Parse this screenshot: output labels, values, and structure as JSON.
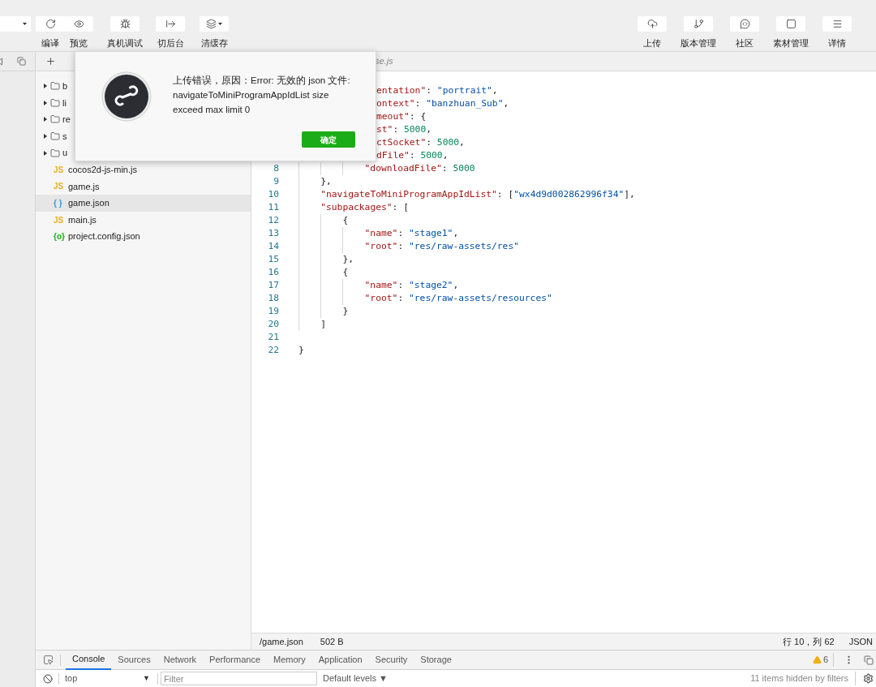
{
  "toolbar": {
    "left": [
      {
        "label": "编译",
        "dropdown": false
      },
      {
        "label": "预览",
        "dropdown": false
      },
      {
        "label": "真机调试",
        "dropdown": false
      },
      {
        "label": "切后台",
        "dropdown": false
      },
      {
        "label": "清缓存",
        "dropdown": true
      }
    ],
    "right": [
      {
        "label": "上传"
      },
      {
        "label": "版本管理"
      },
      {
        "label": "社区"
      },
      {
        "label": "素材管理"
      },
      {
        "label": "详情"
      }
    ]
  },
  "editor_tab": {
    "label": "se.js"
  },
  "file_tree": [
    {
      "kind": "folder",
      "label": "b",
      "selected": false
    },
    {
      "kind": "folder",
      "label": "li",
      "selected": false
    },
    {
      "kind": "folder",
      "label": "re",
      "selected": false
    },
    {
      "kind": "folder",
      "label": "s",
      "selected": false
    },
    {
      "kind": "folder",
      "label": "u",
      "selected": false
    },
    {
      "kind": "js",
      "icon_text": "JS",
      "label": "cocos2d-js-min.js",
      "selected": false
    },
    {
      "kind": "js",
      "icon_text": "JS",
      "label": "game.js",
      "selected": false
    },
    {
      "kind": "json",
      "icon_text": "{ }",
      "label": "game.json",
      "selected": true
    },
    {
      "kind": "js",
      "icon_text": "JS",
      "label": "main.js",
      "selected": false
    },
    {
      "kind": "config",
      "icon_text": "{o}",
      "label": "project.config.json",
      "selected": false
    }
  ],
  "code": [
    {
      "kind": "partial",
      "tokens": [
        {
          "kind": "key",
          "text": "entation\""
        },
        {
          "kind": "punct",
          "text": ": "
        },
        {
          "kind": "string",
          "text": "\"portrait\""
        },
        {
          "kind": "punct",
          "text": ","
        }
      ]
    },
    {
      "kind": "partial",
      "tokens": [
        {
          "kind": "key",
          "text": "ontext\""
        },
        {
          "kind": "punct",
          "text": ": "
        },
        {
          "kind": "string",
          "text": "\"banzhuan_Sub\""
        },
        {
          "kind": "punct",
          "text": ","
        }
      ]
    },
    {
      "kind": "partial",
      "tokens": [
        {
          "kind": "key",
          "text": "meout\""
        },
        {
          "kind": "punct",
          "text": ": {"
        }
      ]
    },
    {
      "kind": "partial",
      "tokens": [
        {
          "kind": "key",
          "text": "st\""
        },
        {
          "kind": "punct",
          "text": ": "
        },
        {
          "kind": "number",
          "text": "5000"
        },
        {
          "kind": "punct",
          "text": ","
        }
      ]
    },
    {
      "kind": "partial",
      "tokens": [
        {
          "kind": "key",
          "text": "ctSocket\""
        },
        {
          "kind": "punct",
          "text": ": "
        },
        {
          "kind": "number",
          "text": "5000"
        },
        {
          "kind": "punct",
          "text": ","
        }
      ]
    },
    {
      "kind": "partial",
      "tokens": [
        {
          "kind": "key",
          "text": "dFile\""
        },
        {
          "kind": "punct",
          "text": ": "
        },
        {
          "kind": "number",
          "text": "5000"
        },
        {
          "kind": "punct",
          "text": ","
        }
      ]
    },
    {
      "kind": "full",
      "number": "8",
      "guides": [
        true,
        true,
        true
      ],
      "tokens": [
        {
          "kind": "key",
          "text": "\"downloadFile\""
        },
        {
          "kind": "punct",
          "text": ": "
        },
        {
          "kind": "number",
          "text": "5000"
        }
      ]
    },
    {
      "kind": "full",
      "number": "9",
      "guides": [
        true
      ],
      "tokens": [
        {
          "kind": "punct",
          "text": "},"
        }
      ]
    },
    {
      "kind": "full",
      "number": "10",
      "guides": [
        true
      ],
      "tokens": [
        {
          "kind": "key",
          "text": "\"navigateToMiniProgramAppIdList\""
        },
        {
          "kind": "punct",
          "text": ": ["
        },
        {
          "kind": "string",
          "text": "\"wx4d9d002862996f34\""
        },
        {
          "kind": "punct",
          "text": "],"
        }
      ]
    },
    {
      "kind": "full",
      "number": "11",
      "guides": [
        true
      ],
      "tokens": [
        {
          "kind": "key",
          "text": "\"subpackages\""
        },
        {
          "kind": "punct",
          "text": ": ["
        }
      ]
    },
    {
      "kind": "full",
      "number": "12",
      "guides": [
        true,
        true
      ],
      "tokens": [
        {
          "kind": "punct",
          "text": "{"
        }
      ]
    },
    {
      "kind": "full",
      "number": "13",
      "guides": [
        true,
        true,
        true
      ],
      "tokens": [
        {
          "kind": "key",
          "text": "\"name\""
        },
        {
          "kind": "punct",
          "text": ": "
        },
        {
          "kind": "string",
          "text": "\"stage1\""
        },
        {
          "kind": "punct",
          "text": ","
        }
      ]
    },
    {
      "kind": "full",
      "number": "14",
      "guides": [
        true,
        true,
        true
      ],
      "tokens": [
        {
          "kind": "key",
          "text": "\"root\""
        },
        {
          "kind": "punct",
          "text": ": "
        },
        {
          "kind": "string",
          "text": "\"res/raw-assets/res\""
        }
      ]
    },
    {
      "kind": "full",
      "number": "15",
      "guides": [
        true,
        true
      ],
      "tokens": [
        {
          "kind": "punct",
          "text": "},"
        }
      ]
    },
    {
      "kind": "full",
      "number": "16",
      "guides": [
        true,
        true
      ],
      "tokens": [
        {
          "kind": "punct",
          "text": "{"
        }
      ]
    },
    {
      "kind": "full",
      "number": "17",
      "guides": [
        true,
        true,
        true
      ],
      "tokens": [
        {
          "kind": "key",
          "text": "\"name\""
        },
        {
          "kind": "punct",
          "text": ": "
        },
        {
          "kind": "string",
          "text": "\"stage2\""
        },
        {
          "kind": "punct",
          "text": ","
        }
      ]
    },
    {
      "kind": "full",
      "number": "18",
      "guides": [
        true,
        true,
        true
      ],
      "tokens": [
        {
          "kind": "key",
          "text": "\"root\""
        },
        {
          "kind": "punct",
          "text": ": "
        },
        {
          "kind": "string",
          "text": "\"res/raw-assets/resources\""
        }
      ]
    },
    {
      "kind": "full",
      "number": "19",
      "guides": [
        true,
        true
      ],
      "tokens": [
        {
          "kind": "punct",
          "text": "}"
        }
      ]
    },
    {
      "kind": "full",
      "number": "20",
      "guides": [
        true
      ],
      "tokens": [
        {
          "kind": "punct",
          "text": "]"
        }
      ]
    },
    {
      "kind": "full",
      "number": "21"
    },
    {
      "kind": "full",
      "number": "22",
      "tokens": [
        {
          "kind": "punct",
          "text": "}"
        }
      ]
    }
  ],
  "status_bar": {
    "path": "/game.json",
    "size": "502 B",
    "position": "行 10，列 62",
    "language": "JSON"
  },
  "devtools": {
    "tabs": [
      {
        "label": "Console",
        "selected": true
      },
      {
        "label": "Sources",
        "selected": false
      },
      {
        "label": "Network",
        "selected": false
      },
      {
        "label": "Performance",
        "selected": false
      },
      {
        "label": "Memory",
        "selected": false
      },
      {
        "label": "Application",
        "selected": false
      },
      {
        "label": "Security",
        "selected": false
      },
      {
        "label": "Storage",
        "selected": false
      }
    ],
    "warning_count": "6",
    "context": "top",
    "context_caret": "▼",
    "filter_placeholder": "Filter",
    "levels": "Default levels ▼",
    "hidden_note": "11 items hidden by filters"
  },
  "dialog": {
    "message": "上传错误，原因：Error: 无效的 json 文件: navigateToMiniProgramAppIdList size exceed max limit 0",
    "button": "确定"
  }
}
